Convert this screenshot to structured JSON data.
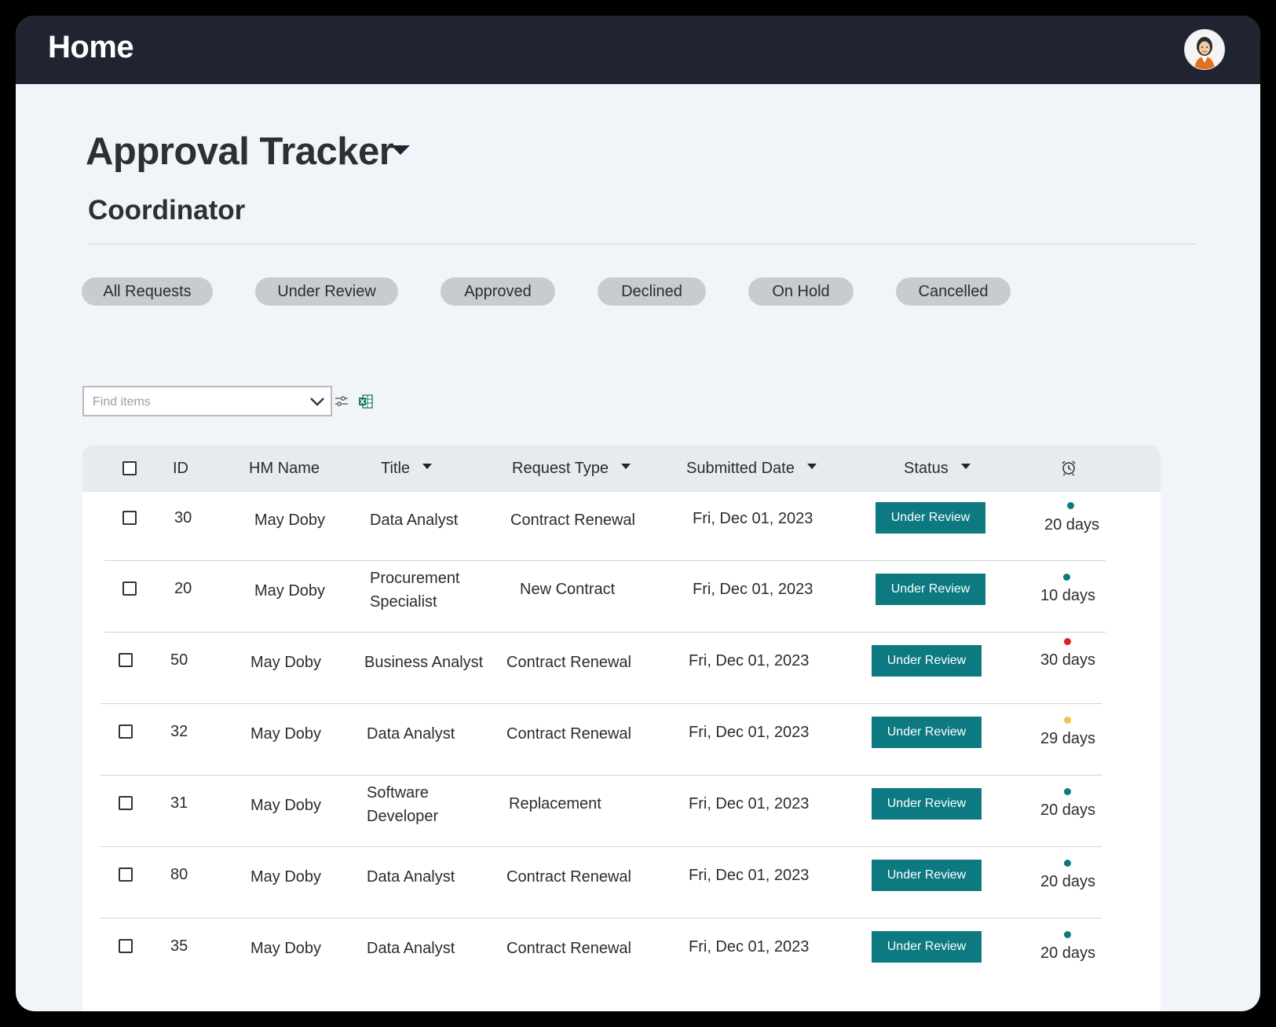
{
  "header": {
    "title": "Home",
    "avatar_icon": "user-avatar-icon"
  },
  "page": {
    "title": "Approval Tracker",
    "subtitle": "Coordinator"
  },
  "filters": [
    {
      "label": "All Requests"
    },
    {
      "label": "Under Review"
    },
    {
      "label": "Approved"
    },
    {
      "label": "Declined"
    },
    {
      "label": "On Hold"
    },
    {
      "label": "Cancelled"
    }
  ],
  "search": {
    "placeholder": "Find items",
    "value": ""
  },
  "toolbar": {
    "filter_icon": "sliders-icon",
    "export_icon": "excel-icon"
  },
  "table": {
    "columns": {
      "id": "ID",
      "hm_name": "HM Name",
      "title": "Title",
      "request_type": "Request Type",
      "submitted_date": "Submitted Date",
      "status": "Status",
      "aging_icon": "alarm-clock-icon"
    },
    "rows": [
      {
        "id": "30",
        "hm_name": "May Doby",
        "title": "Data Analyst",
        "request_type": "Contract Renewal",
        "submitted_date": "Fri, Dec 01, 2023",
        "status": "Under Review",
        "aging": "20 days",
        "aging_color": "#0c7a80"
      },
      {
        "id": "20",
        "hm_name": "May Doby",
        "title": "Procurement Specialist",
        "request_type": "New Contract",
        "submitted_date": "Fri, Dec 01, 2023",
        "status": "Under Review",
        "aging": "10 days",
        "aging_color": "#0c7a80"
      },
      {
        "id": "50",
        "hm_name": "May Doby",
        "title": "Business Analyst",
        "request_type": "Contract Renewal",
        "submitted_date": "Fri, Dec 01, 2023",
        "status": "Under Review",
        "aging": "30 days",
        "aging_color": "#e02020"
      },
      {
        "id": "32",
        "hm_name": "May Doby",
        "title": "Data Analyst",
        "request_type": "Contract Renewal",
        "submitted_date": "Fri, Dec 01, 2023",
        "status": "Under Review",
        "aging": "29 days",
        "aging_color": "#f2c14e"
      },
      {
        "id": "31",
        "hm_name": "May Doby",
        "title": "Software Developer",
        "request_type": "Replacement",
        "submitted_date": "Fri, Dec 01, 2023",
        "status": "Under Review",
        "aging": "20 days",
        "aging_color": "#0c7a80"
      },
      {
        "id": "80",
        "hm_name": "May Doby",
        "title": "Data Analyst",
        "request_type": "Contract Renewal",
        "submitted_date": "Fri, Dec 01, 2023",
        "status": "Under Review",
        "aging": "20 days",
        "aging_color": "#0c7a80"
      },
      {
        "id": "35",
        "hm_name": "May Doby",
        "title": "Data Analyst",
        "request_type": "Contract Renewal",
        "submitted_date": "Fri, Dec 01, 2023",
        "status": "Under Review",
        "aging": "20 days",
        "aging_color": "#0c7a80"
      }
    ]
  },
  "colors": {
    "topbar": "#1f2430",
    "accent": "#0c7a80",
    "background": "#f1f4f8"
  }
}
